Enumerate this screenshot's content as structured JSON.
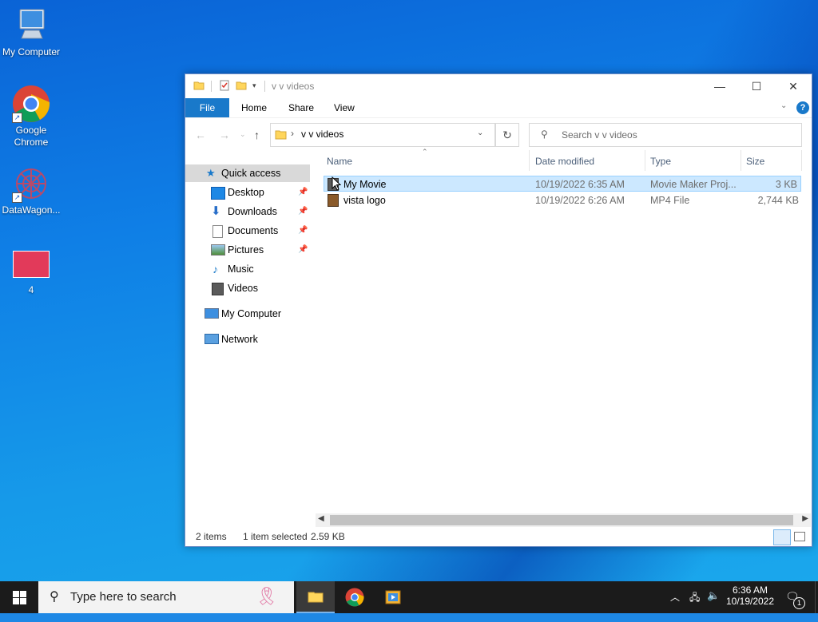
{
  "desktop": {
    "icons": [
      {
        "label": "My Computer",
        "icon": "computer-icon"
      },
      {
        "label": "Google Chrome",
        "icon": "chrome-icon"
      },
      {
        "label": "DataWagon...",
        "icon": "datawagon-icon"
      },
      {
        "label": "4",
        "icon": "video-thumbnail-icon"
      }
    ]
  },
  "explorer": {
    "title": "v v videos",
    "window_controls": {
      "minimize": "—",
      "maximize": "☐",
      "close": "✕"
    },
    "ribbon_tabs": [
      "File",
      "Home",
      "Share",
      "View"
    ],
    "address": {
      "path": "v v videos",
      "separator": "›"
    },
    "search_placeholder": "Search v v videos",
    "nav": {
      "quick_access": "Quick access",
      "items": [
        {
          "label": "Desktop",
          "icon": "desktop-icon",
          "pinned": true
        },
        {
          "label": "Downloads",
          "icon": "downloads-icon",
          "pinned": true
        },
        {
          "label": "Documents",
          "icon": "documents-icon",
          "pinned": true
        },
        {
          "label": "Pictures",
          "icon": "pictures-icon",
          "pinned": true
        },
        {
          "label": "Music",
          "icon": "music-icon",
          "pinned": false
        },
        {
          "label": "Videos",
          "icon": "videos-icon",
          "pinned": false
        }
      ],
      "my_computer": "My Computer",
      "network": "Network"
    },
    "columns": [
      "Name",
      "Date modified",
      "Type",
      "Size"
    ],
    "files": [
      {
        "name": "My Movie",
        "date": "10/19/2022 6:35 AM",
        "type": "Movie Maker Proj...",
        "size": "3 KB",
        "selected": true
      },
      {
        "name": "vista logo",
        "date": "10/19/2022 6:26 AM",
        "type": "MP4 File",
        "size": "2,744 KB",
        "selected": false
      }
    ],
    "status": {
      "count": "2 items",
      "selection": "1 item selected",
      "size": "2.59 KB"
    }
  },
  "taskbar": {
    "search_placeholder": "Type here to search",
    "apps": [
      "file-explorer-icon",
      "chrome-icon",
      "movie-maker-icon"
    ],
    "clock": {
      "time": "6:36 AM",
      "date": "10/19/2022"
    },
    "notification_count": "1"
  },
  "colors": {
    "accent": "#1979ca",
    "selection": "#cce8ff",
    "taskbar": "#1b1b1b"
  }
}
